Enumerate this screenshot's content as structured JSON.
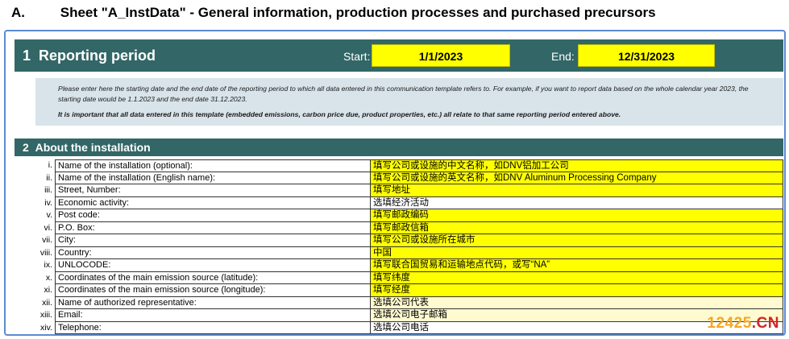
{
  "title": {
    "letter": "A.",
    "text": "Sheet \"A_InstData\" - General information, production processes and purchased precursors"
  },
  "reporting_period": {
    "number": "1",
    "title": "Reporting period",
    "start_label": "Start:",
    "start_value": "1/1/2023",
    "end_label": "End:",
    "end_value": "12/31/2023"
  },
  "note": {
    "line1": "Please enter here the starting date and the end date of the reporting period to which all data entered in this communication template refers to. For example, if you want to report data based on the whole calendar year 2023, the starting date would be 1.1.2023 and the end date 31.12.2023.",
    "line2": "It is important that all data entered in this template (embedded emissions, carbon price due, product properties, etc.) all relate to that same reporting period entered above."
  },
  "installation": {
    "number": "2",
    "title": "About the installation",
    "rows": [
      {
        "idx": "i.",
        "label": "Name of the installation (optional):",
        "value": "填写公司或设施的中文名称，如DNV铝加工公司",
        "style": "yellow"
      },
      {
        "idx": "ii.",
        "label": "Name of the installation (English name):",
        "value": "填写公司或设施的英文名称，如DNV Aluminum Processing Company",
        "style": "yellow"
      },
      {
        "idx": "iii.",
        "label": "Street, Number:",
        "value": "填写地址",
        "style": "yellow"
      },
      {
        "idx": "iv.",
        "label": "Economic activity:",
        "value": "选填经济活动",
        "style": "white"
      },
      {
        "idx": "v.",
        "label": "Post code:",
        "value": "填写邮政编码",
        "style": "yellow"
      },
      {
        "idx": "vi.",
        "label": "P.O. Box:",
        "value": "填写邮政信箱",
        "style": "yellow"
      },
      {
        "idx": "vii.",
        "label": "City:",
        "value": "填写公司或设施所在城市",
        "style": "yellow"
      },
      {
        "idx": "viii.",
        "label": "Country:",
        "value": "中国",
        "style": "yellow"
      },
      {
        "idx": "ix.",
        "label": "UNLOCODE:",
        "value": "填写联合国贸易和运输地点代码，或写“NA”",
        "style": "yellow"
      },
      {
        "idx": "x.",
        "label": "Coordinates of the main emission source (latitude):",
        "value": "填写纬度",
        "style": "yellow"
      },
      {
        "idx": "xi.",
        "label": "Coordinates of the main emission source (longitude):",
        "value": "填写经度",
        "style": "yellow"
      },
      {
        "idx": "xii.",
        "label": "Name of authorized representative:",
        "value": "选填公司代表",
        "style": "light"
      },
      {
        "idx": "xiii.",
        "label": "Email:",
        "value": "选填公司电子邮箱",
        "style": "light"
      },
      {
        "idx": "xiv.",
        "label": "Telephone:",
        "value": "选填公司电话",
        "style": "white"
      }
    ]
  },
  "watermark": {
    "part1": "12425",
    "part2": ".CN"
  }
}
